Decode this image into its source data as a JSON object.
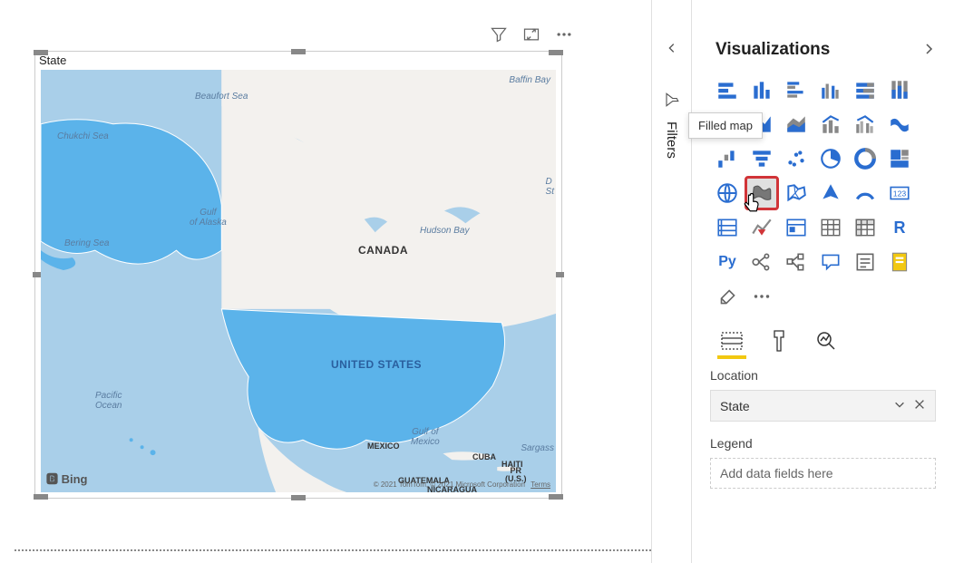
{
  "visual_toolbar": {
    "filter_icon": "filter-icon",
    "focus_icon": "focus-mode-icon",
    "more_icon": "more-options-icon"
  },
  "map": {
    "title": "State",
    "labels": {
      "beaufort": "Beaufort Sea",
      "baffin": "Baffin Bay",
      "chukchi": "Chukchi Sea",
      "bering": "Bering Sea",
      "gulf_alaska": "Gulf\nof Alaska",
      "hudson": "Hudson Bay",
      "ds": "D\nSt",
      "canada": "CANADA",
      "united_states": "UNITED STATES",
      "pacific": "Pacific\nOcean",
      "gulf_mexico": "Gulf of\nMexico",
      "sargas": "Sargass",
      "mexico": "MEXICO",
      "cuba": "CUBA",
      "haiti": "HAITI",
      "pr": "PR\n(U.S.)",
      "guatemala": "GUATEMALA",
      "nicaragua": "NICARAGUA"
    },
    "bing_logo": "🅱 Bing",
    "attribution": "© 2021 TomTom, © 2021 Microsoft Corporation",
    "terms": "Terms"
  },
  "filters_pane": {
    "label": "Filters"
  },
  "viz_pane": {
    "title": "Visualizations",
    "tooltip": "Filled map",
    "fields_tab": "fields",
    "format_tab": "format",
    "analytics_tab": "analytics",
    "sections": {
      "location": {
        "label": "Location",
        "field": "State"
      },
      "legend": {
        "label": "Legend",
        "placeholder": "Add data fields here"
      }
    }
  }
}
